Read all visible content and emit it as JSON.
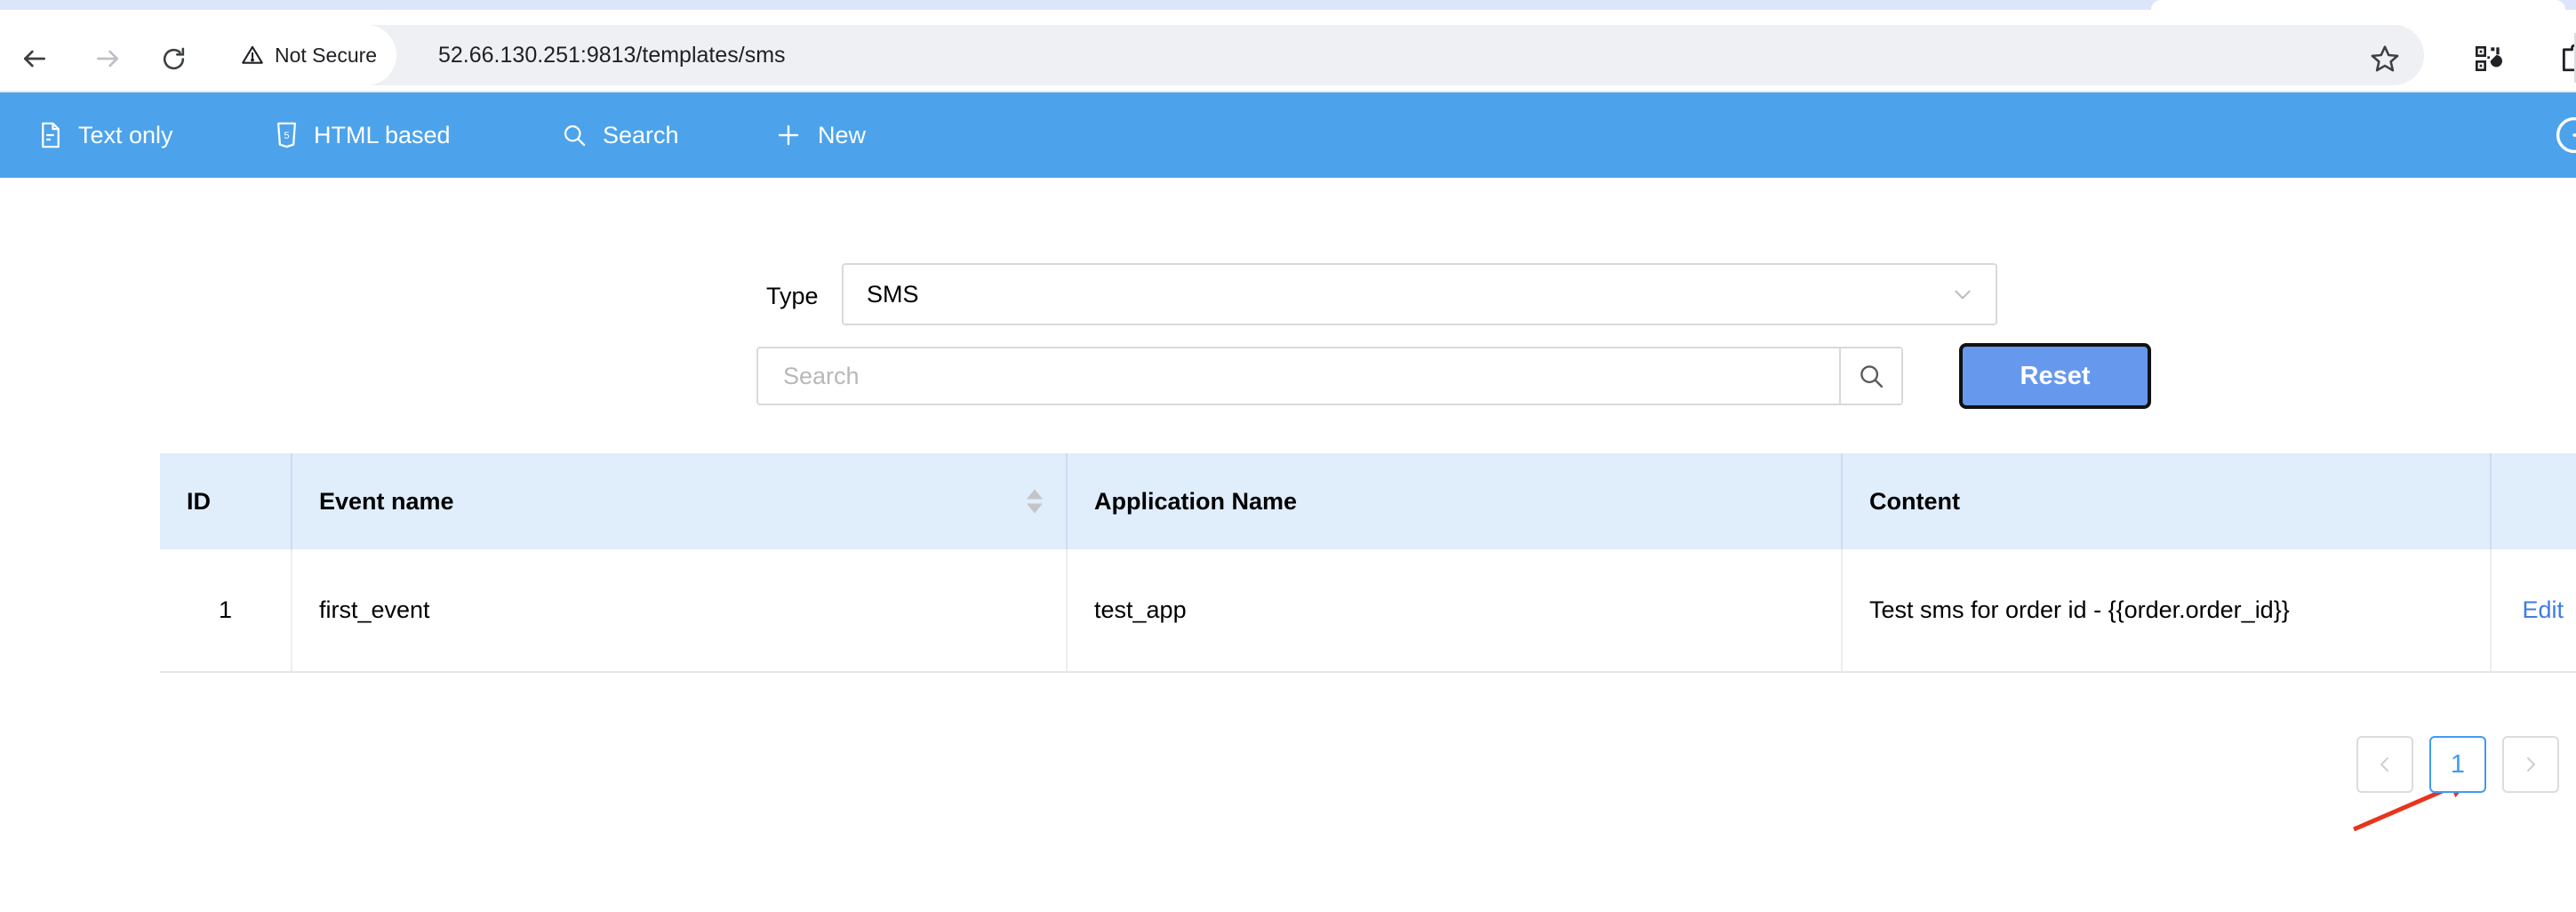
{
  "browser": {
    "security_label": "Not Secure",
    "url": "52.66.130.251:9813/templates/sms",
    "back_icon": "back-arrow-icon",
    "forward_icon": "forward-arrow-icon",
    "reload_icon": "reload-icon",
    "warning_icon": "warning-triangle-icon",
    "bookmark_icon": "star-icon",
    "qr_icon": "qr-code-icon",
    "extensions_icon": "puzzle-piece-icon"
  },
  "navbar": {
    "items": [
      {
        "label": "Text only",
        "icon": "document-icon"
      },
      {
        "label": "HTML based",
        "icon": "html5-icon"
      },
      {
        "label": "Search",
        "icon": "search-icon"
      },
      {
        "label": "New",
        "icon": "plus-icon"
      }
    ],
    "logout_icon": "logout-circle-icon"
  },
  "filters": {
    "type_label": "Type",
    "type_value": "SMS",
    "type_options": [
      "SMS"
    ],
    "search_placeholder": "Search",
    "search_value": "",
    "search_icon": "search-icon",
    "reset_label": "Reset",
    "reset_color": "#6699ee"
  },
  "table": {
    "columns": [
      {
        "key": "id",
        "label": "ID",
        "sortable": false
      },
      {
        "key": "event",
        "label": "Event name",
        "sortable": true
      },
      {
        "key": "app",
        "label": "Application Name",
        "sortable": false
      },
      {
        "key": "content",
        "label": "Content",
        "sortable": false
      },
      {
        "key": "action",
        "label": "",
        "sortable": false
      }
    ],
    "rows": [
      {
        "id": "1",
        "event": "first_event",
        "app": "test_app",
        "content": "Test sms for order id - {{order.order_id}}",
        "action_label": "Edit"
      }
    ],
    "header_bg": "#e0edfb",
    "link_color": "#3e7bea"
  },
  "pagination": {
    "prev_label": "‹",
    "next_label": "›",
    "current_page": "1",
    "active_color": "#3e9bf5"
  },
  "annotation": {
    "arrow_color": "#e8341c",
    "points_to": "Edit"
  }
}
